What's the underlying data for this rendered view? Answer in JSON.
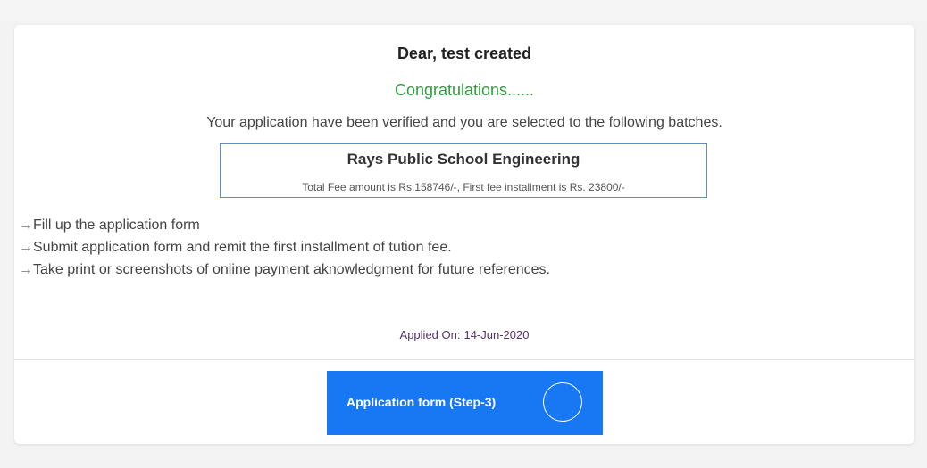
{
  "greeting": {
    "prefix": "Dear,",
    "name": "test created"
  },
  "congratulations": "Congratulations......",
  "verified_message": "Your application have been verified and you are selected to the following batches.",
  "batch": {
    "name": "Rays Public School Engineering",
    "fee_text": "Total Fee amount is Rs.158746/-, First fee installment is Rs. 23800/-"
  },
  "instructions": [
    {
      "icon": "arrow-right-icon",
      "text": "Fill up the application form"
    },
    {
      "icon": "arrow-right-icon",
      "text": "Submit application form and remit the first installment of tution fee."
    },
    {
      "icon": "arrow-right-icon",
      "text": "Take print or screenshots of online payment aknowledgment for future references."
    }
  ],
  "applied": {
    "label": "Applied On:",
    "date": "14-Jun-2020"
  },
  "step_button": {
    "label": "Application form (Step-3)",
    "icon": "loading-spinner-icon"
  },
  "colors": {
    "accent": "#1877f2",
    "success": "#2e9e3e",
    "box_border": "#5b8fc7"
  }
}
